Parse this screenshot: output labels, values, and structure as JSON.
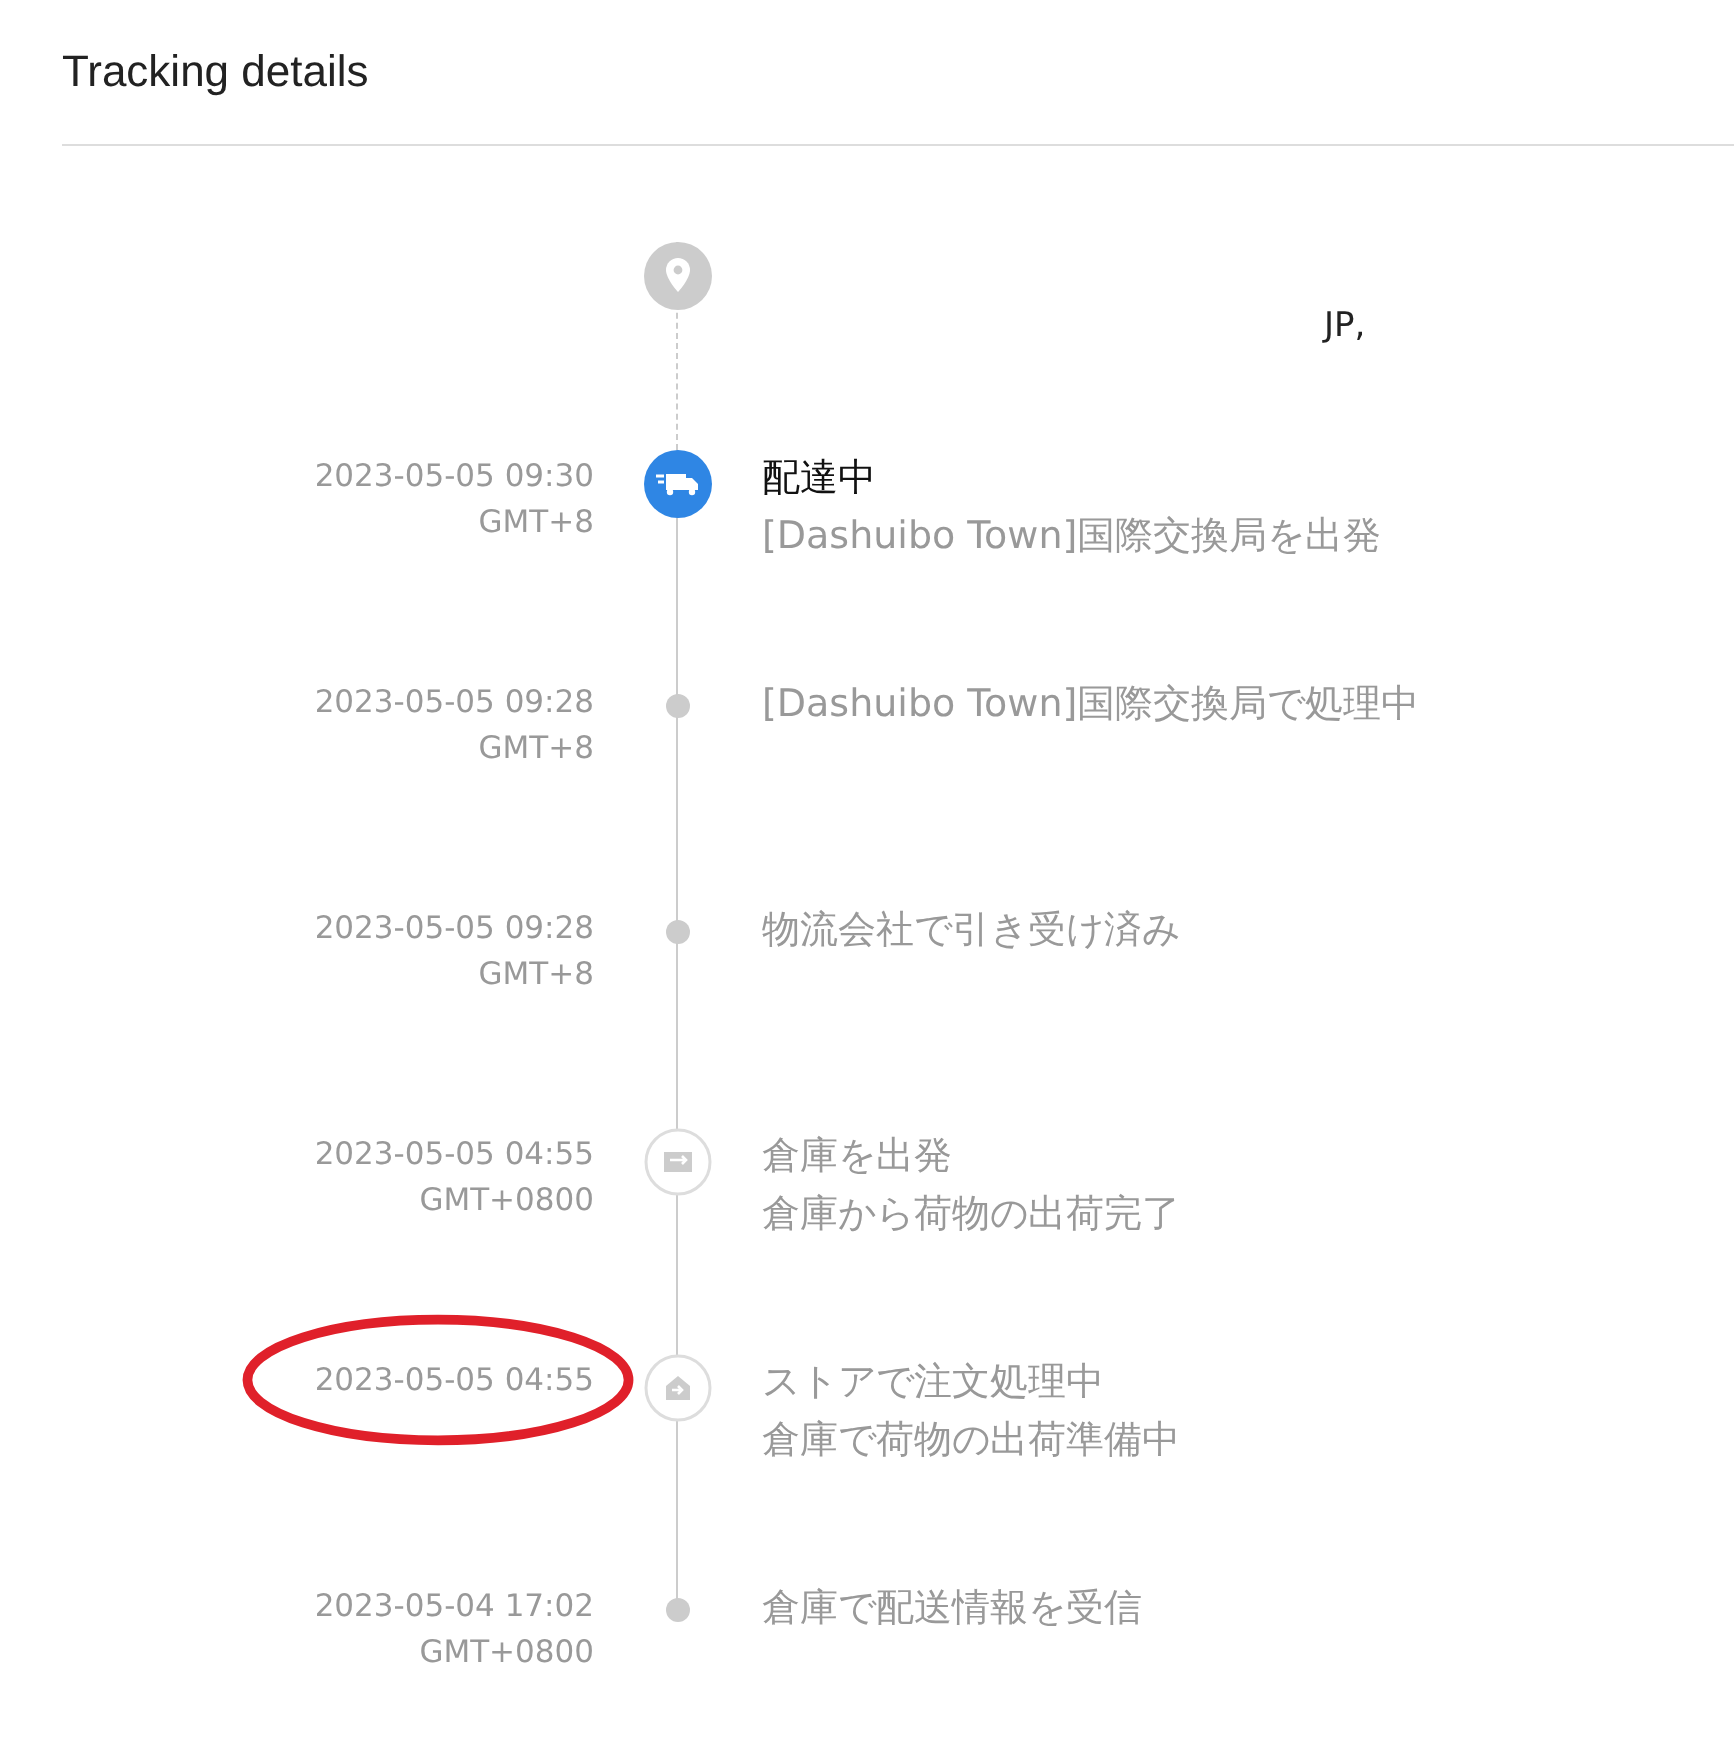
{
  "title": "Tracking details",
  "destination": {
    "text": "JP,"
  },
  "events": [
    {
      "kind": "active",
      "date": "2023-05-05 09:30",
      "zone": "GMT+8",
      "status": "配達中",
      "detail": "[Dashuibo Town]国際交換局を出発"
    },
    {
      "kind": "dot",
      "date": "2023-05-05 09:28",
      "zone": "GMT+8",
      "status": "[Dashuibo Town]国際交換局で処理中"
    },
    {
      "kind": "dot",
      "date": "2023-05-05 09:28",
      "zone": "GMT+8",
      "status": "物流会社で引き受け済み"
    },
    {
      "kind": "warehouse",
      "date": "2023-05-05 04:55",
      "zone": "GMT+0800",
      "status": "倉庫を出発",
      "detail": "倉庫から荷物の出荷完了"
    },
    {
      "kind": "store",
      "date": "2023-05-05 04:55",
      "status": "ストアで注文処理中",
      "detail": "倉庫で荷物の出荷準備中",
      "circled": true
    },
    {
      "kind": "dot",
      "date": "2023-05-04 17:02",
      "zone": "GMT+0800",
      "status": "倉庫で配送情報を受信"
    }
  ]
}
